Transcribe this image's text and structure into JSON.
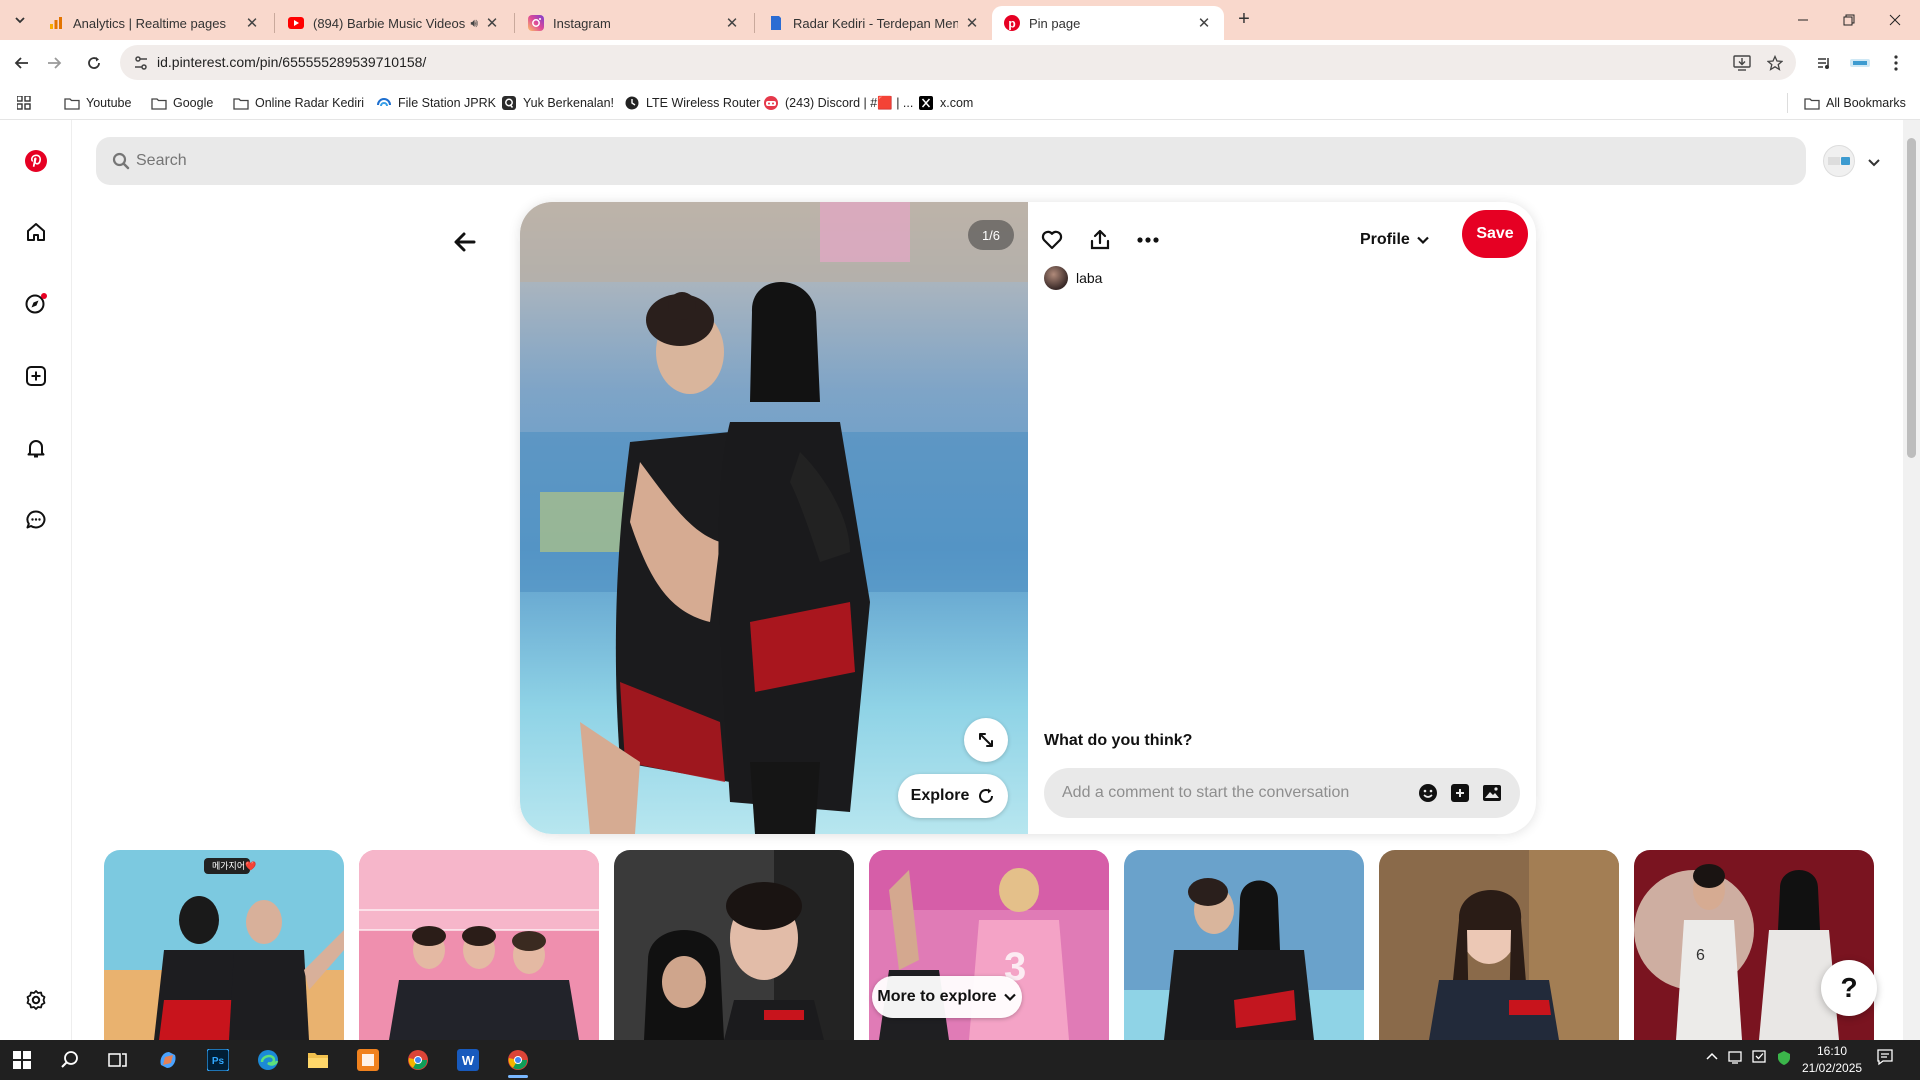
{
  "browser": {
    "tabs": [
      {
        "title": "Analytics | Realtime pages",
        "icon": "analytics-icon"
      },
      {
        "title": "(894) Barbie Music Videos |",
        "icon": "youtube-icon"
      },
      {
        "title": "Instagram",
        "icon": "instagram-icon"
      },
      {
        "title": "Radar Kediri - Terdepan Menga",
        "icon": "radar-kediri-icon"
      },
      {
        "title": "Pin page",
        "icon": "pinterest-icon",
        "active": true
      }
    ],
    "url": "id.pinterest.com/pin/655555289539710158/",
    "bookmarks": [
      {
        "label": "Youtube",
        "icon": "folder-icon"
      },
      {
        "label": "Google",
        "icon": "folder-icon"
      },
      {
        "label": "Online Radar Kediri",
        "icon": "folder-icon"
      },
      {
        "label": "File Station JPRK",
        "icon": "file-station-icon"
      },
      {
        "label": "Yuk Berkenalan!",
        "icon": "quora-icon"
      },
      {
        "label": "LTE Wireless Router",
        "icon": "router-icon"
      },
      {
        "label": "(243) Discord | #🟥 | ...",
        "icon": "discord-icon"
      },
      {
        "label": "x.com",
        "icon": "x-icon"
      }
    ],
    "all_bookmarks": "All Bookmarks"
  },
  "pinterest": {
    "search_placeholder": "Search",
    "pin": {
      "counter": "1/6",
      "explore_label": "Explore",
      "profile_label": "Profile",
      "save_label": "Save",
      "author": "laba",
      "comment_heading": "What do you think?",
      "comment_placeholder": "Add a comment to start the conversation"
    },
    "more_to_explore": "More to explore",
    "help_label": "?",
    "thumbnail_overlay_text": "메가지어❤️",
    "brand_color": "#e60023"
  },
  "taskbar": {
    "time": "16:10",
    "date": "21/02/2025"
  }
}
